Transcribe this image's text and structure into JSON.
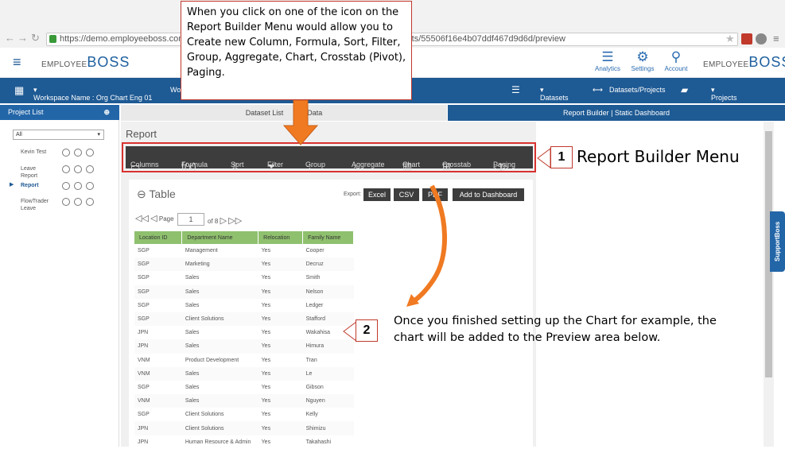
{
  "browser": {
    "url_prefix": "https://demo.employeeboss.com/l",
    "url_suffix": "rts/55506f16e4b07ddf467d9d6d/preview"
  },
  "app": {
    "logo_small": "EMPLOYEE",
    "logo_big": "BOSS",
    "header_icons": [
      {
        "name": "analytics-icon",
        "label": "Analytics"
      },
      {
        "name": "settings-icon",
        "label": "Settings"
      },
      {
        "name": "account-icon",
        "label": "Account"
      }
    ]
  },
  "nav": {
    "workspace": "Workspace Name : Org Chart Eng 01",
    "wo": "Wo",
    "datasets": "Datasets",
    "datasets_projects": "Datasets/Projects",
    "projects": "Projects"
  },
  "tabs": {
    "project_list": "Project List",
    "dataset_list": "Dataset List",
    "data": "Data",
    "report_builder": "Report Builder | Static Dashboard"
  },
  "sidebar": {
    "filter": "All",
    "projects": [
      {
        "label": "Kevin Test"
      },
      {
        "label": "Leave\nReport"
      },
      {
        "label": "Report"
      },
      {
        "label": "FlowTrader\nLeave"
      }
    ]
  },
  "report": {
    "title": "Report",
    "menu": [
      {
        "label": "Columns",
        "icon": "columns-icon",
        "glyph": "▭"
      },
      {
        "label": "Formula",
        "icon": "formula-icon",
        "glyph": "f(x)"
      },
      {
        "label": "Sort",
        "icon": "sort-icon",
        "glyph": "⇳"
      },
      {
        "label": "Filter",
        "icon": "filter-icon",
        "glyph": "⏷"
      },
      {
        "label": "Group",
        "icon": "group-icon",
        "glyph": "⁘"
      },
      {
        "label": "Aggregate",
        "icon": "aggregate-icon",
        "glyph": "♁"
      },
      {
        "label": "Chart",
        "icon": "chart-icon",
        "glyph": "▥"
      },
      {
        "label": "Crosstab",
        "icon": "crosstab-icon",
        "glyph": "⊞"
      },
      {
        "label": "Paging",
        "icon": "paging-icon",
        "glyph": "◁▷"
      }
    ]
  },
  "table": {
    "title": "Table",
    "export_label": "Export:",
    "export_buttons": [
      "Excel",
      "CSV",
      "PDF",
      "Add to Dashboard"
    ],
    "pager": {
      "page_label": "Page",
      "page_value": "1",
      "of_label": "of 8"
    },
    "columns": [
      "Location ID",
      "Department Name",
      "Relocation",
      "Family Name"
    ],
    "rows": [
      [
        "SGP",
        "Management",
        "Yes",
        "Cooper"
      ],
      [
        "SGP",
        "Marketing",
        "Yes",
        "Decruz"
      ],
      [
        "SGP",
        "Sales",
        "Yes",
        "Smith"
      ],
      [
        "SGP",
        "Sales",
        "Yes",
        "Nelson"
      ],
      [
        "SGP",
        "Sales",
        "Yes",
        "Ledger"
      ],
      [
        "SGP",
        "Client Solutions",
        "Yes",
        "Stafford"
      ],
      [
        "JPN",
        "Sales",
        "Yes",
        "Wakahisa"
      ],
      [
        "JPN",
        "Sales",
        "Yes",
        "Himura"
      ],
      [
        "VNM",
        "Product Development",
        "Yes",
        "Tran"
      ],
      [
        "VNM",
        "Sales",
        "Yes",
        "Le"
      ],
      [
        "SGP",
        "Sales",
        "Yes",
        "Gibson"
      ],
      [
        "VNM",
        "Sales",
        "Yes",
        "Nguyen"
      ],
      [
        "SGP",
        "Client Solutions",
        "Yes",
        "Kelly"
      ],
      [
        "JPN",
        "Client Solutions",
        "Yes",
        "Shimizu"
      ],
      [
        "JPN",
        "Human Resource & Admin",
        "Yes",
        "Takahashi"
      ]
    ]
  },
  "support": "SupportBoss",
  "annotations": {
    "callout": "When you click on one of the icon on the Report Builder Menu would allow you to Create new Column, Formula, Sort, Filter, Group, Aggregate, Chart, Crosstab (Pivot), Paging.",
    "num1": "1",
    "text1": "Report Builder Menu",
    "num2": "2",
    "text2": "Once you finished setting up the Chart for example, the chart will be added to the Preview area below.",
    "accent": "#c0392b",
    "arrow_color": "#f07a22"
  }
}
